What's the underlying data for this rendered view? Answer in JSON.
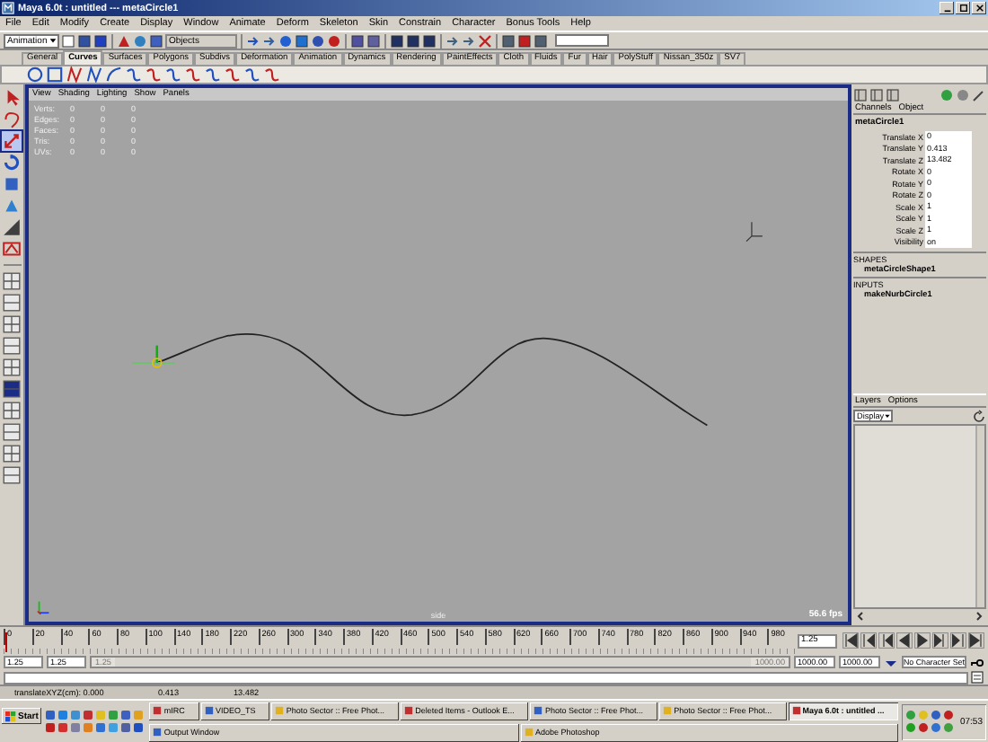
{
  "window": {
    "title": "Maya 6.0t : untitled   ---   metaCircle1"
  },
  "menu_bar": [
    "File",
    "Edit",
    "Modify",
    "Create",
    "Display",
    "Window",
    "Animate",
    "Deform",
    "Skeleton",
    "Skin",
    "Constrain",
    "Character",
    "Bonus Tools",
    "Help"
  ],
  "status_line": {
    "mode": "Animation",
    "selection_mode": "Objects"
  },
  "shelf_tabs": [
    {
      "label": "General",
      "selected": false
    },
    {
      "label": "Curves",
      "selected": true
    },
    {
      "label": "Surfaces",
      "selected": false
    },
    {
      "label": "Polygons",
      "selected": false
    },
    {
      "label": "Subdivs",
      "selected": false
    },
    {
      "label": "Deformation",
      "selected": false
    },
    {
      "label": "Animation",
      "selected": false
    },
    {
      "label": "Dynamics",
      "selected": false
    },
    {
      "label": "Rendering",
      "selected": false
    },
    {
      "label": "PaintEffects",
      "selected": false
    },
    {
      "label": "Cloth",
      "selected": false
    },
    {
      "label": "Fluids",
      "selected": false
    },
    {
      "label": "Fur",
      "selected": false
    },
    {
      "label": "Hair",
      "selected": false
    },
    {
      "label": "PolyStuff",
      "selected": false
    },
    {
      "label": "Nissan_350z",
      "selected": false
    },
    {
      "label": "SV7",
      "selected": false
    }
  ],
  "toolbox": [
    {
      "kind": "select",
      "selected": false
    },
    {
      "kind": "lasso",
      "selected": false
    },
    {
      "kind": "move",
      "selected": true
    },
    {
      "kind": "rotate",
      "selected": false
    },
    {
      "kind": "scale",
      "selected": false
    },
    {
      "kind": "universal",
      "selected": false
    },
    {
      "kind": "soft",
      "selected": false
    },
    {
      "kind": "manip",
      "selected": false
    }
  ],
  "viewport": {
    "menu": [
      "View",
      "Shading",
      "Lighting",
      "Show",
      "Panels"
    ],
    "hud": [
      {
        "label": "Verts:",
        "values": [
          "0",
          "0",
          "0"
        ]
      },
      {
        "label": "Edges:",
        "values": [
          "0",
          "0",
          "0"
        ]
      },
      {
        "label": "Faces:",
        "values": [
          "0",
          "0",
          "0"
        ]
      },
      {
        "label": "Tris:",
        "values": [
          "0",
          "0",
          "0"
        ]
      },
      {
        "label": "UVs:",
        "values": [
          "0",
          "0",
          "0"
        ]
      }
    ],
    "camera": "side",
    "fps": "56.6 fps"
  },
  "channel_box": {
    "tabs": [
      "Channels",
      "Object"
    ],
    "node": "metaCircle1",
    "attributes": [
      {
        "name": "Translate X",
        "value": "0"
      },
      {
        "name": "Translate Y",
        "value": "0.413"
      },
      {
        "name": "Translate Z",
        "value": "13.482"
      },
      {
        "name": "Rotate X",
        "value": "0"
      },
      {
        "name": "Rotate Y",
        "value": "0"
      },
      {
        "name": "Rotate Z",
        "value": "0"
      },
      {
        "name": "Scale X",
        "value": "1"
      },
      {
        "name": "Scale Y",
        "value": "1"
      },
      {
        "name": "Scale Z",
        "value": "1"
      },
      {
        "name": "Visibility",
        "value": "on"
      }
    ],
    "shapes_header": "SHAPES",
    "shape": "metaCircleShape1",
    "inputs_header": "INPUTS",
    "input": "makeNurbCircle1"
  },
  "layer_editor": {
    "menu": [
      "Layers",
      "Options"
    ],
    "dropdown": "Display"
  },
  "timeline": {
    "ticks": [
      "0",
      "20",
      "40",
      "60",
      "80",
      "100",
      "140",
      "180",
      "220",
      "260",
      "300",
      "340",
      "380",
      "420",
      "460",
      "500",
      "540",
      "580",
      "620",
      "660",
      "700",
      "740",
      "780",
      "820",
      "860",
      "900",
      "940",
      "980"
    ],
    "current_frame": "1.25",
    "level": 0.002
  },
  "range": {
    "start": "1.25",
    "playback_start": "1.25",
    "slider_start": "1.25",
    "slider_end": "1000.00",
    "playback_end": "1000.00",
    "end": "1000.00",
    "character_set": "No Character Set",
    "level": 1
  },
  "help_line": [
    "translateXYZ(cm): 0.000",
    "0.413",
    "13.482"
  ],
  "taskbar": {
    "start": "Start",
    "tasks": [
      {
        "label": "mIRC",
        "selected": false
      },
      {
        "label": "VIDEO_TS",
        "selected": false
      },
      {
        "label": "Photo Sector :: Free Phot...",
        "selected": false
      },
      {
        "label": "Deleted Items - Outlook E...",
        "selected": false
      },
      {
        "label": "Photo Sector :: Free Phot...",
        "selected": false
      },
      {
        "label": "Photo Sector :: Free Phot...",
        "selected": false
      },
      {
        "label": "Maya 6.0t : untitled ...",
        "selected": true
      },
      {
        "label": "Output Window",
        "selected": false
      },
      {
        "label": "Adobe Photoshop",
        "selected": false
      }
    ],
    "clock": "07:53"
  }
}
